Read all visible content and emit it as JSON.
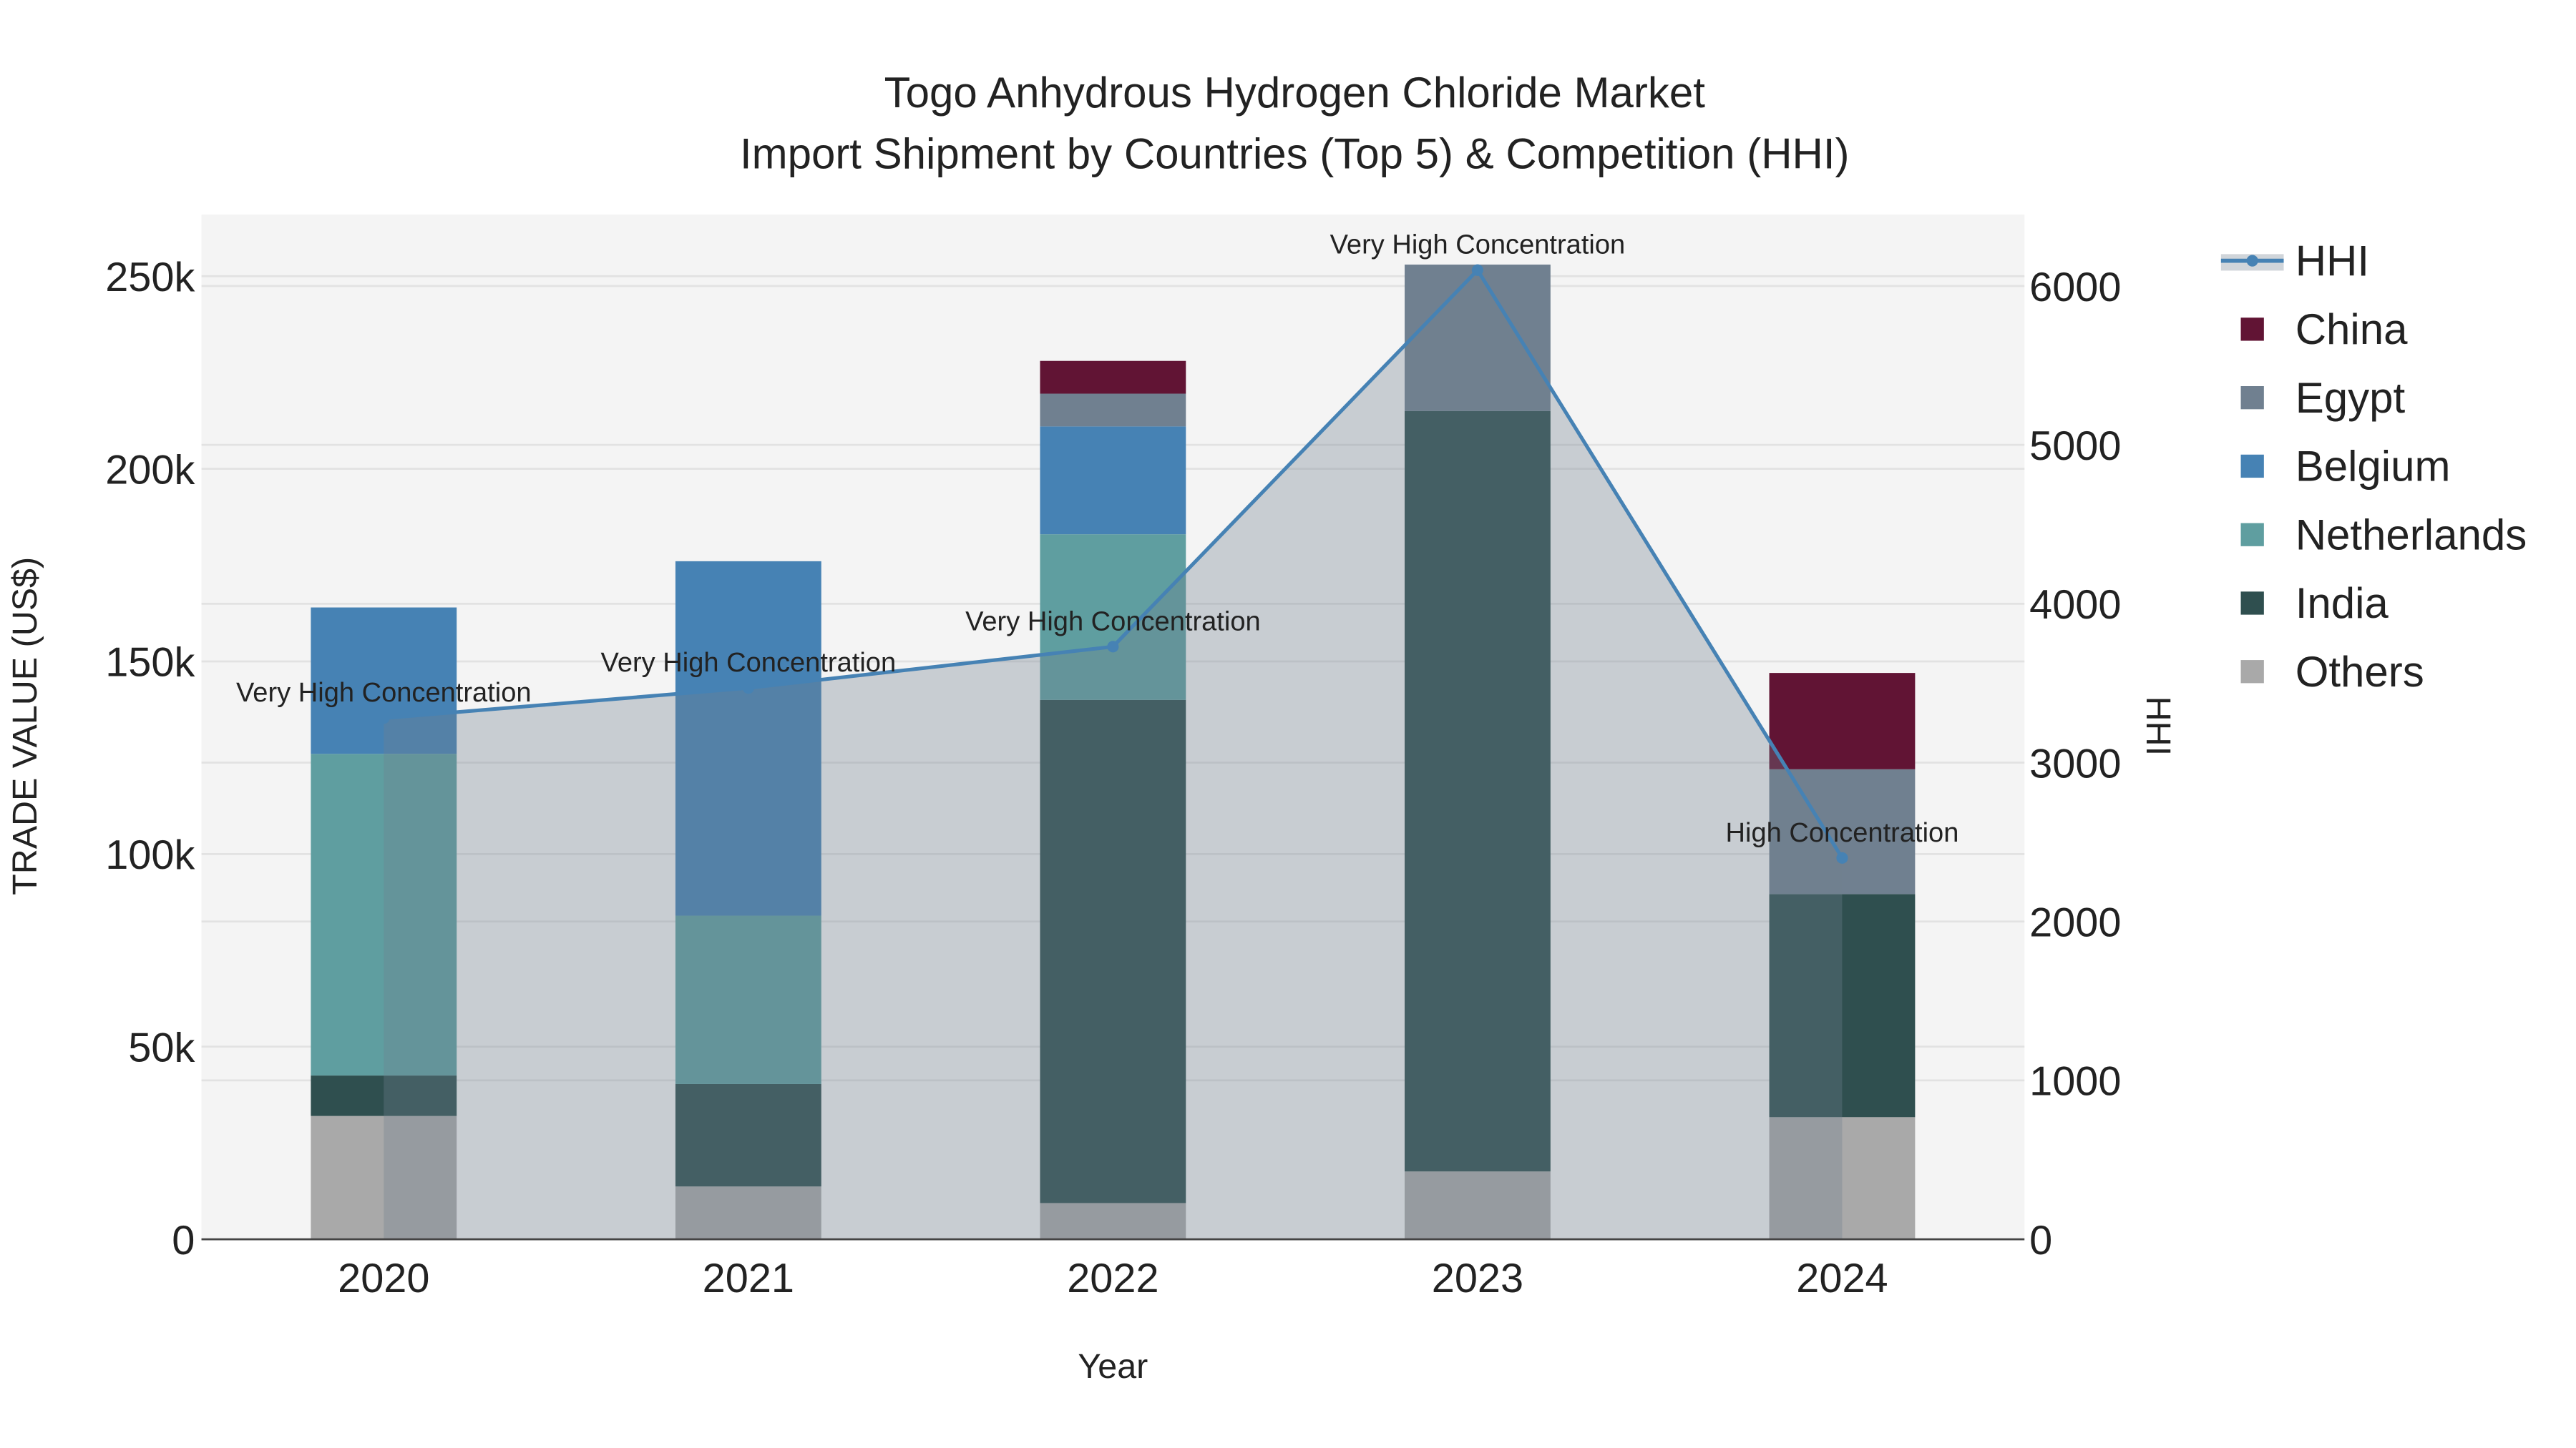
{
  "chart_data": {
    "type": "bar",
    "title_line1": "Togo Anhydrous Hydrogen Chloride Market",
    "title_line2": "Import Shipment by Countries (Top 5) & Competition (HHI)",
    "xlabel": "Year",
    "ylabel": "TRADE VALUE (US$)",
    "y2label": "HHI",
    "categories": [
      "2020",
      "2021",
      "2022",
      "2023",
      "2024"
    ],
    "ylim": [
      0,
      266000
    ],
    "y2lim": [
      0,
      6450
    ],
    "yticks": [
      0,
      50000,
      100000,
      150000,
      200000,
      250000
    ],
    "ytick_labels": [
      "0",
      "50k",
      "100k",
      "150k",
      "200k",
      "250k"
    ],
    "y2ticks": [
      0,
      1000,
      2000,
      3000,
      4000,
      5000,
      6000
    ],
    "y2tick_labels": [
      "0",
      "1000",
      "2000",
      "3000",
      "4000",
      "5000",
      "6000"
    ],
    "stacked": true,
    "series": [
      {
        "name": "Others",
        "color": "#A9A9A9",
        "values": [
          32000,
          13700,
          9400,
          17600,
          31700
        ]
      },
      {
        "name": "India",
        "color": "#2F4F4F",
        "values": [
          10500,
          26600,
          130600,
          197400,
          57900
        ]
      },
      {
        "name": "Netherlands",
        "color": "#5F9EA0",
        "values": [
          83500,
          43700,
          43000,
          0,
          0
        ]
      },
      {
        "name": "Belgium",
        "color": "#4682B4",
        "values": [
          38000,
          92000,
          28000,
          0,
          0
        ]
      },
      {
        "name": "Egypt",
        "color": "#708090",
        "values": [
          0,
          0,
          8500,
          38000,
          32400
        ]
      },
      {
        "name": "China",
        "color": "#611434",
        "values": [
          0,
          0,
          8500,
          0,
          25000
        ]
      }
    ],
    "hhi": {
      "name": "HHI",
      "color": "#4682B4",
      "values": [
        3280,
        3470,
        3730,
        6100,
        2400
      ],
      "annotations": [
        "Very High Concentration",
        "Very High Concentration",
        "Very High Concentration",
        "Very High Concentration",
        "High Concentration"
      ]
    },
    "legend": [
      "HHI",
      "China",
      "Egypt",
      "Belgium",
      "Netherlands",
      "India",
      "Others"
    ],
    "legend_placement": "right",
    "grid": true
  }
}
